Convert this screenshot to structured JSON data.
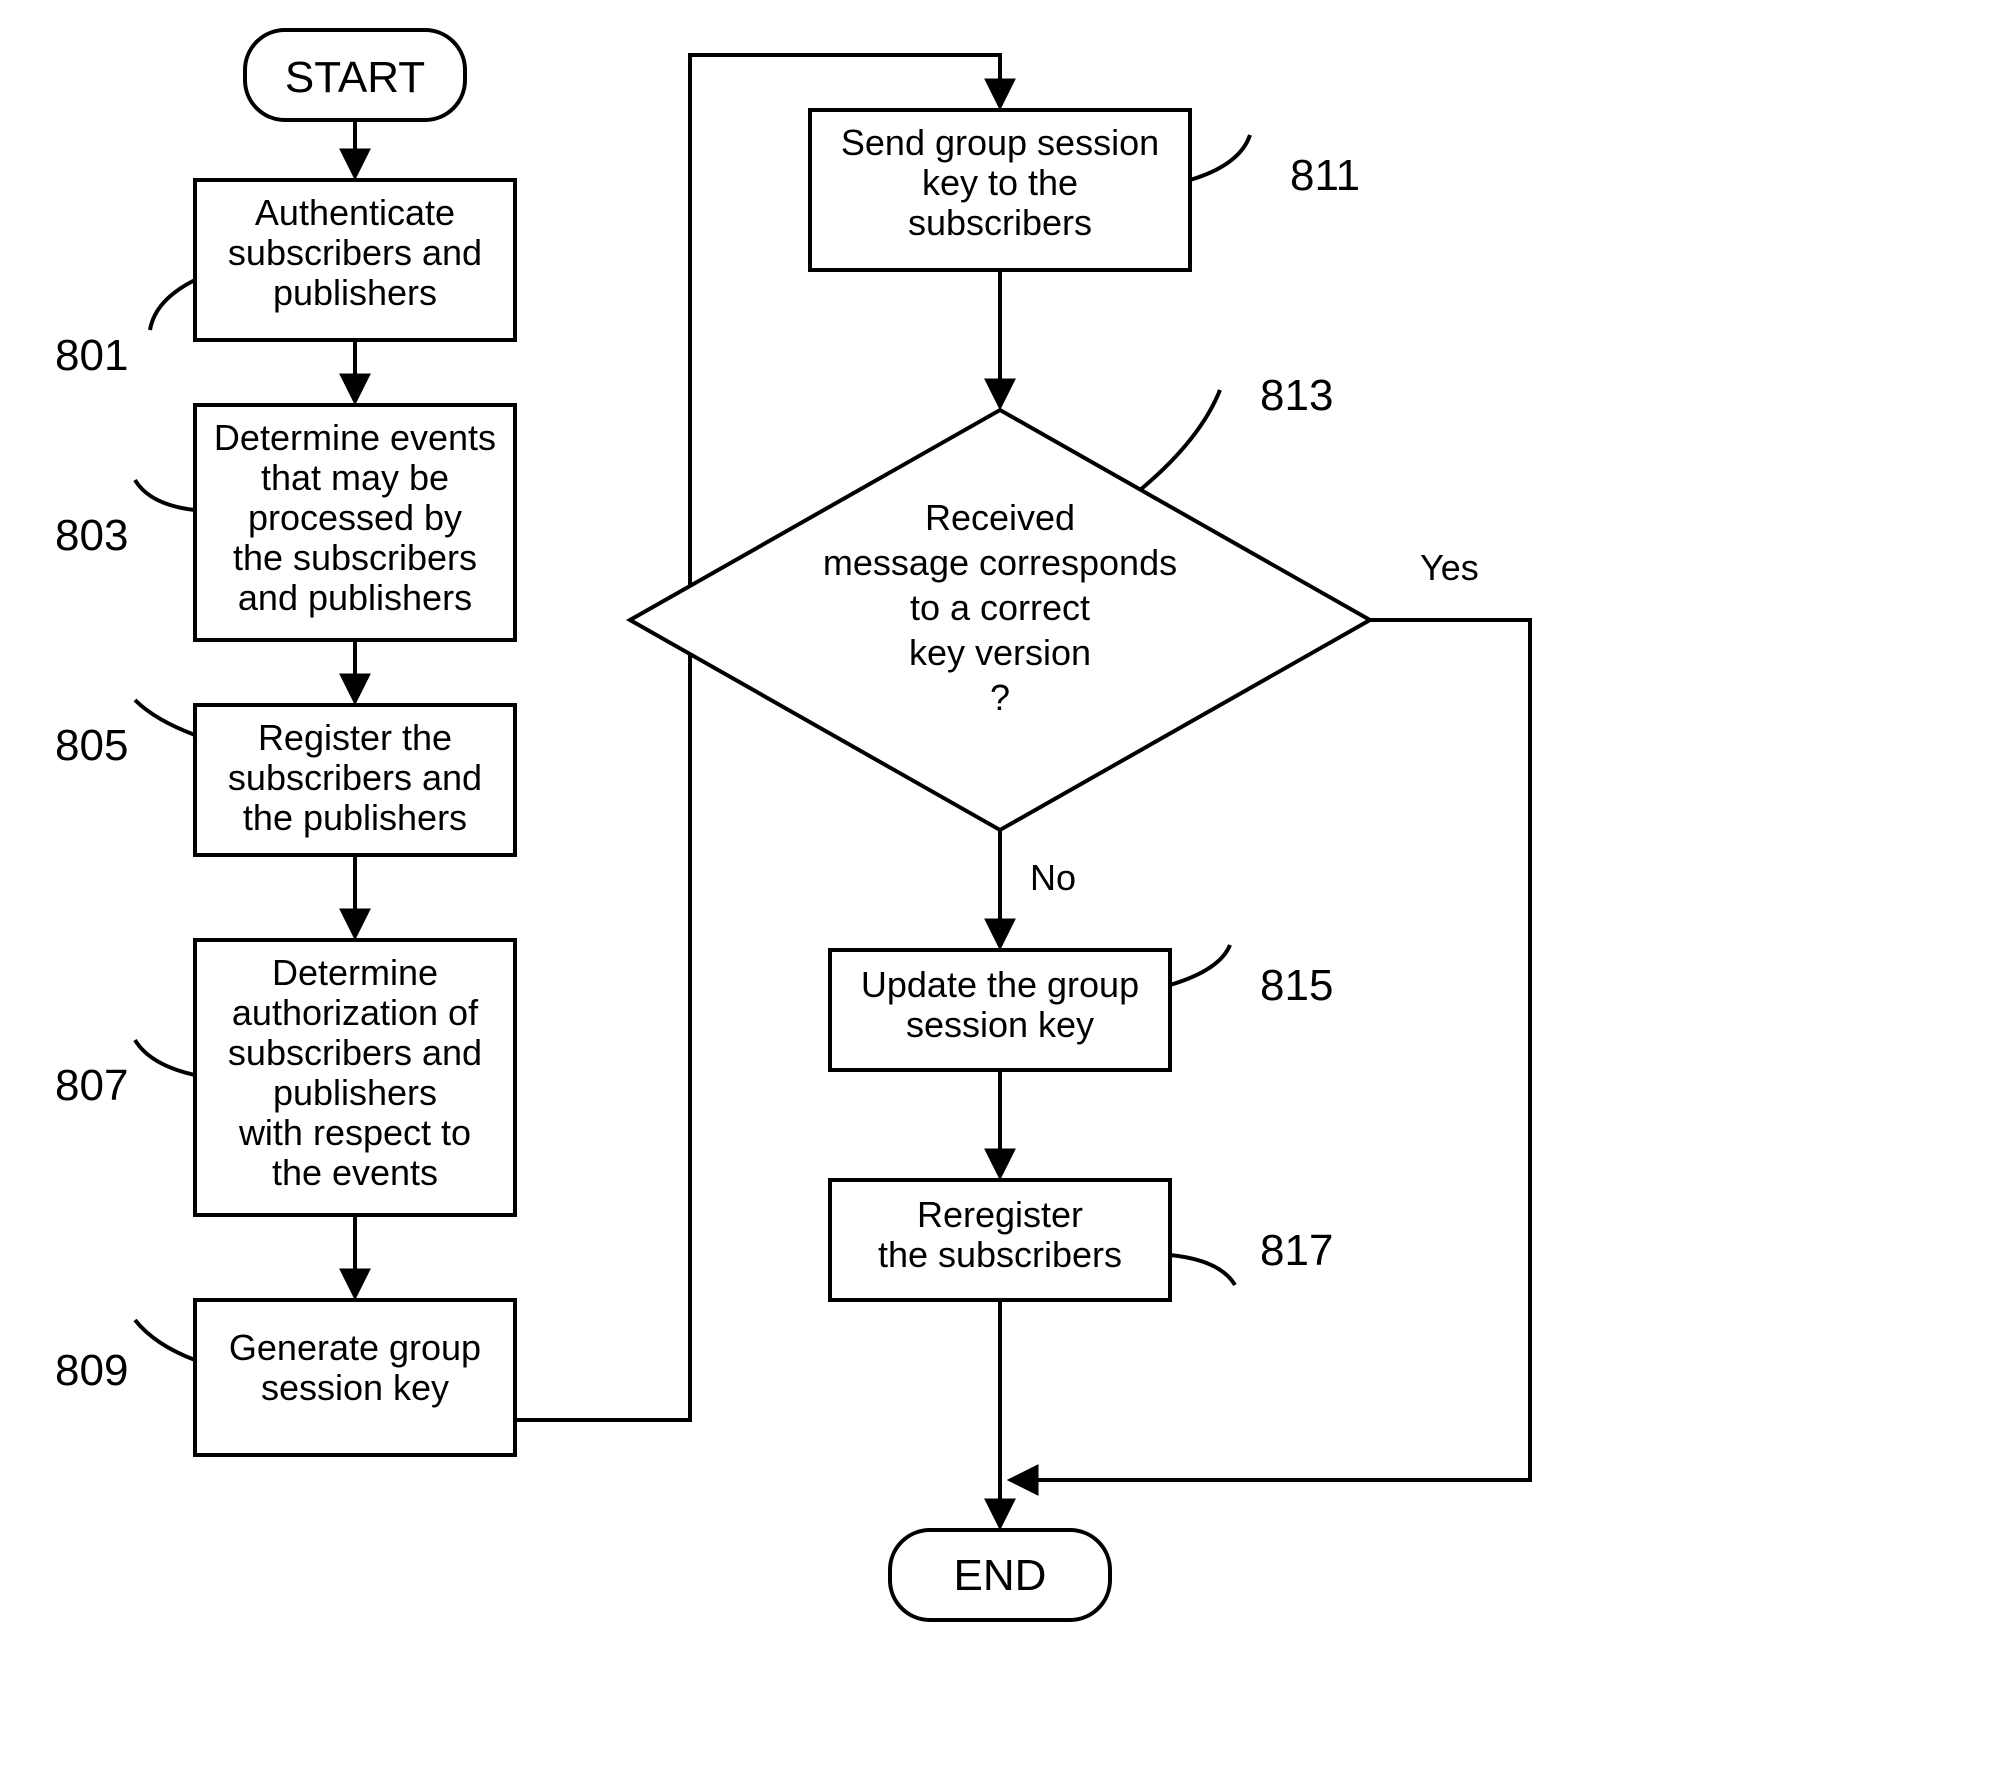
{
  "terminators": {
    "start": "START",
    "end": "END"
  },
  "boxes": {
    "b801": {
      "l1": "Authenticate",
      "l2": "subscribers and",
      "l3": "publishers"
    },
    "b803": {
      "l1": "Determine events",
      "l2": "that may be",
      "l3": "processed by",
      "l4": "the subscribers",
      "l5": "and publishers"
    },
    "b805": {
      "l1": "Register the",
      "l2": "subscribers and",
      "l3": "the publishers"
    },
    "b807": {
      "l1": "Determine",
      "l2": "authorization of",
      "l3": "subscribers and",
      "l4": "publishers",
      "l5": "with respect to",
      "l6": "the events"
    },
    "b809": {
      "l1": "Generate group",
      "l2": "session key"
    },
    "b811": {
      "l1": "Send group session",
      "l2": "key to the",
      "l3": "subscribers"
    },
    "b815": {
      "l1": "Update the group",
      "l2": "session key"
    },
    "b817": {
      "l1": "Reregister",
      "l2": "the subscribers"
    }
  },
  "decision": {
    "d813": {
      "l1": "Received",
      "l2": "message corresponds",
      "l3": "to a correct",
      "l4": "key version",
      "l5": "?"
    }
  },
  "refs": {
    "r801": "801",
    "r803": "803",
    "r805": "805",
    "r807": "807",
    "r809": "809",
    "r811": "811",
    "r813": "813",
    "r815": "815",
    "r817": "817"
  },
  "edges": {
    "yes": "Yes",
    "no": "No"
  }
}
